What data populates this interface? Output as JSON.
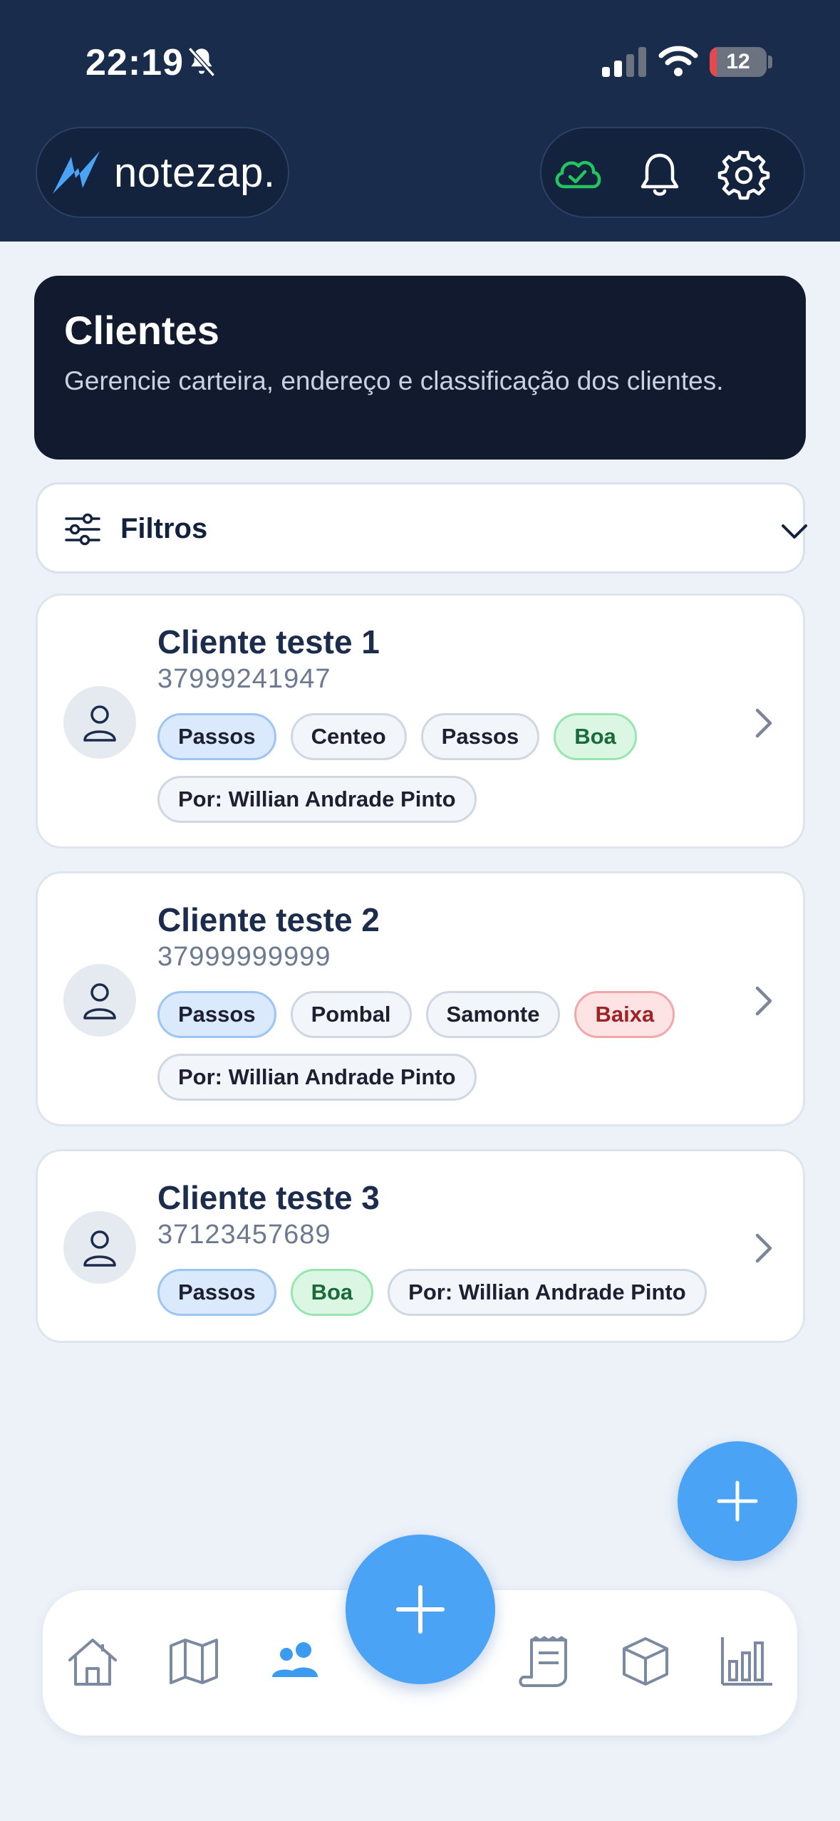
{
  "status_bar": {
    "time": "22:19",
    "battery": "12",
    "battery_level": 0.12
  },
  "header": {
    "brand": "notezap."
  },
  "page": {
    "title": "Clientes",
    "subtitle": "Gerencie carteira, endereço e classificação dos clientes."
  },
  "filter": {
    "label": "Filtros"
  },
  "clients": [
    {
      "name": "Cliente teste 1",
      "phone": "37999241947",
      "tags": [
        {
          "text": "Passos",
          "style": "blue"
        },
        {
          "text": "Centeo",
          "style": "gray"
        },
        {
          "text": "Passos",
          "style": "gray"
        },
        {
          "text": "Boa",
          "style": "green"
        },
        {
          "text": "Por: Willian Andrade Pinto",
          "style": "gray"
        }
      ]
    },
    {
      "name": "Cliente teste 2",
      "phone": "37999999999",
      "tags": [
        {
          "text": "Passos",
          "style": "blue"
        },
        {
          "text": "Pombal",
          "style": "gray"
        },
        {
          "text": "Samonte",
          "style": "gray"
        },
        {
          "text": "Baixa",
          "style": "red"
        },
        {
          "text": "Por: Willian Andrade Pinto",
          "style": "gray"
        }
      ]
    },
    {
      "name": "Cliente teste 3",
      "phone": "37123457689",
      "tags": [
        {
          "text": "Passos",
          "style": "blue"
        },
        {
          "text": "Boa",
          "style": "green"
        },
        {
          "text": "Por: Willian Andrade Pinto",
          "style": "gray"
        }
      ]
    }
  ],
  "icons": {
    "header_actions": [
      "cloud-check-icon",
      "bell-icon",
      "gear-icon"
    ],
    "nav": [
      "home-icon",
      "map-icon",
      "users-icon",
      "receipt-icon",
      "box-icon",
      "chart-icon"
    ]
  },
  "colors": {
    "header_bg": "#1a2c4b",
    "accent": "#4aa3f5",
    "active_nav": "#3b9bf0",
    "cloud_ok": "#22c55e"
  }
}
